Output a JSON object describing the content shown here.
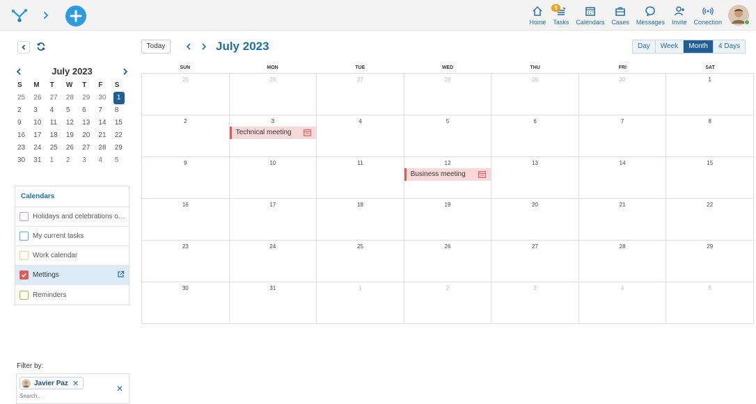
{
  "topbar": {
    "nav": [
      {
        "name": "home",
        "label": "Home",
        "icon": "home-icon"
      },
      {
        "name": "tasks",
        "label": "Tasks",
        "icon": "tasks-icon",
        "badge": "9"
      },
      {
        "name": "calendars",
        "label": "Calendars",
        "icon": "calendar-icon"
      },
      {
        "name": "cases",
        "label": "Cases",
        "icon": "briefcase-icon"
      },
      {
        "name": "messages",
        "label": "Messages",
        "icon": "chat-bubble-icon"
      },
      {
        "name": "invite",
        "label": "Invite",
        "icon": "add-user-icon"
      },
      {
        "name": "conection",
        "label": "Conection",
        "icon": "wireless-icon"
      }
    ],
    "accent": "#2d9be0",
    "nav_color": "#1d6fa8"
  },
  "mini_calendar": {
    "title": "July 2023",
    "weekdays": [
      "S",
      "M",
      "T",
      "W",
      "T",
      "F",
      "S"
    ],
    "days": [
      [
        "25",
        "26",
        "27",
        "28",
        "29",
        "30",
        "1"
      ],
      [
        "2",
        "3",
        "4",
        "5",
        "6",
        "7",
        "8"
      ],
      [
        "9",
        "10",
        "11",
        "12",
        "13",
        "14",
        "15"
      ],
      [
        "16",
        "17",
        "18",
        "19",
        "20",
        "21",
        "22"
      ],
      [
        "23",
        "24",
        "25",
        "26",
        "27",
        "28",
        "29"
      ],
      [
        "30",
        "31",
        "1",
        "2",
        "3",
        "4",
        "5"
      ]
    ],
    "selected": "1"
  },
  "calendars": {
    "title": "Calendars",
    "items": [
      {
        "label": "Holidays and celebrations of A...",
        "color": "#e58fb6",
        "checked": false
      },
      {
        "label": "My current tasks",
        "color": "#5aa8e0",
        "checked": false
      },
      {
        "label": "Work calendar",
        "color": "#f3d27a",
        "checked": false
      },
      {
        "label": "Mettings",
        "color": "#e05a5a",
        "checked": true
      },
      {
        "label": "Reminders",
        "color": "#f0a01a",
        "checked": false
      }
    ]
  },
  "filter": {
    "label": "Filter by:",
    "chip": "Javier Paz",
    "search_placeholder": "Search.."
  },
  "toolbar": {
    "today": "Today",
    "title": "July 2023",
    "views": [
      "Day",
      "Week",
      "Month",
      "4 Days"
    ],
    "active_view": "Month"
  },
  "month_view": {
    "weekdays": [
      "SUN",
      "MON",
      "TUE",
      "WED",
      "THU",
      "FRI",
      "SAT"
    ],
    "weeks": [
      [
        {
          "d": "25",
          "m": true
        },
        {
          "d": "26",
          "m": true
        },
        {
          "d": "27",
          "m": true
        },
        {
          "d": "28",
          "m": true
        },
        {
          "d": "29",
          "m": true
        },
        {
          "d": "30",
          "m": true
        },
        {
          "d": "1",
          "m": false
        }
      ],
      [
        {
          "d": "2",
          "m": false
        },
        {
          "d": "3",
          "m": false,
          "event": "Technical meeting"
        },
        {
          "d": "4",
          "m": false
        },
        {
          "d": "5",
          "m": false
        },
        {
          "d": "6",
          "m": false
        },
        {
          "d": "7",
          "m": false
        },
        {
          "d": "8",
          "m": false
        }
      ],
      [
        {
          "d": "9",
          "m": false
        },
        {
          "d": "10",
          "m": false
        },
        {
          "d": "11",
          "m": false
        },
        {
          "d": "12",
          "m": false,
          "event": "Business meeting"
        },
        {
          "d": "13",
          "m": false
        },
        {
          "d": "14",
          "m": false
        },
        {
          "d": "15",
          "m": false
        }
      ],
      [
        {
          "d": "16",
          "m": false
        },
        {
          "d": "17",
          "m": false
        },
        {
          "d": "18",
          "m": false
        },
        {
          "d": "19",
          "m": false
        },
        {
          "d": "20",
          "m": false
        },
        {
          "d": "21",
          "m": false
        },
        {
          "d": "22",
          "m": false
        }
      ],
      [
        {
          "d": "23",
          "m": false
        },
        {
          "d": "24",
          "m": false
        },
        {
          "d": "25",
          "m": false
        },
        {
          "d": "26",
          "m": false
        },
        {
          "d": "27",
          "m": false
        },
        {
          "d": "28",
          "m": false
        },
        {
          "d": "29",
          "m": false
        }
      ],
      [
        {
          "d": "30",
          "m": false
        },
        {
          "d": "31",
          "m": false
        },
        {
          "d": "1",
          "m": true
        },
        {
          "d": "2",
          "m": true
        },
        {
          "d": "3",
          "m": true
        },
        {
          "d": "4",
          "m": true
        },
        {
          "d": "5",
          "m": true
        }
      ]
    ],
    "event_color": "#e05a5a",
    "event_bg": "#f8d9d9"
  }
}
